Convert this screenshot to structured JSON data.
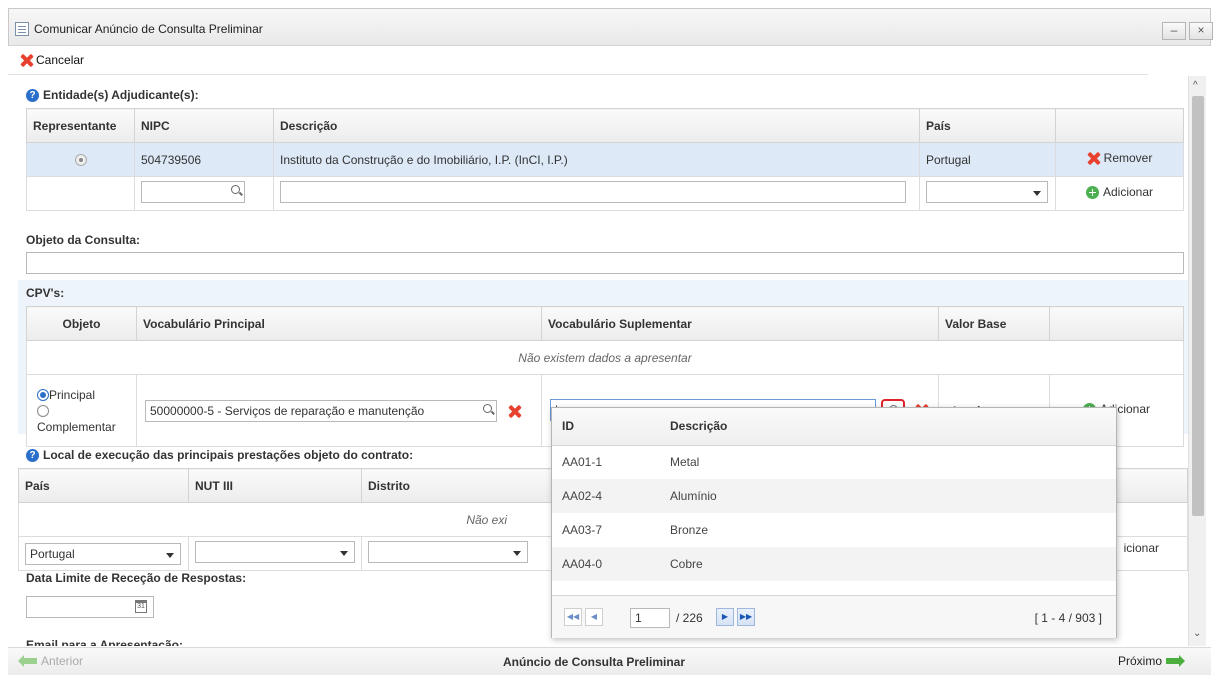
{
  "window": {
    "title": "Comunicar Anúncio de Consulta Preliminar",
    "minimize": "–",
    "close": "×"
  },
  "toolbar": {
    "cancel_label": "Cancelar"
  },
  "entidades": {
    "label": "Entidade(s) Adjudicante(s):",
    "headers": [
      "Representante",
      "NIPC",
      "Descrição",
      "País"
    ],
    "row": {
      "nipc": "504739506",
      "descricao": "Instituto da Construção e do Imobiliário, I.P. (InCI, I.P.)",
      "pais": "Portugal",
      "remove_label": "Remover"
    },
    "add_label": "Adicionar"
  },
  "objeto": {
    "label": "Objeto da Consulta:"
  },
  "cpv": {
    "label": "CPV's:",
    "headers": [
      "Objeto",
      "Vocabulário Principal",
      "Vocabulário Suplementar",
      "Valor Base"
    ],
    "empty_message": "Não existem dados a apresentar",
    "radio_principal": "Principal",
    "radio_complementar": "Complementar",
    "vocabulario_principal_value": "50000000-5 - Serviços de reparação e manutenção",
    "valor_base": "Inexistente",
    "add_label": "Adicionar"
  },
  "local": {
    "label": "Local de execução das principais prestações objeto do contrato:",
    "headers": [
      "País",
      "NUT III",
      "Distrito"
    ],
    "empty_message_partial": "Não exi",
    "pais_value": "Portugal",
    "add_label_partial": "icionar"
  },
  "data_limite": {
    "label": "Data Limite de Receção de Respostas:",
    "calendar_text": "31"
  },
  "email": {
    "label_partial": "Email para a Apresentação:"
  },
  "popup": {
    "headers": [
      "ID",
      "Descrição"
    ],
    "rows": [
      {
        "id": "AA01-1",
        "descricao": "Metal"
      },
      {
        "id": "AA02-4",
        "descricao": "Alumínio"
      },
      {
        "id": "AA03-7",
        "descricao": "Bronze"
      },
      {
        "id": "AA04-0",
        "descricao": "Cobre"
      }
    ],
    "pager": {
      "page": "1",
      "total_pages": "/ 226",
      "range": "[ 1 - 4 / 903 ]"
    }
  },
  "footer": {
    "prev_label": "Anterior",
    "center_title": "Anúncio de Consulta Preliminar",
    "next_label": "Próximo"
  },
  "colors": {
    "accent": "#2a6fc9",
    "remove": "#e8412f",
    "add": "#4caf50",
    "highlight": "#e0222a",
    "selected_row": "#dde9f6"
  }
}
